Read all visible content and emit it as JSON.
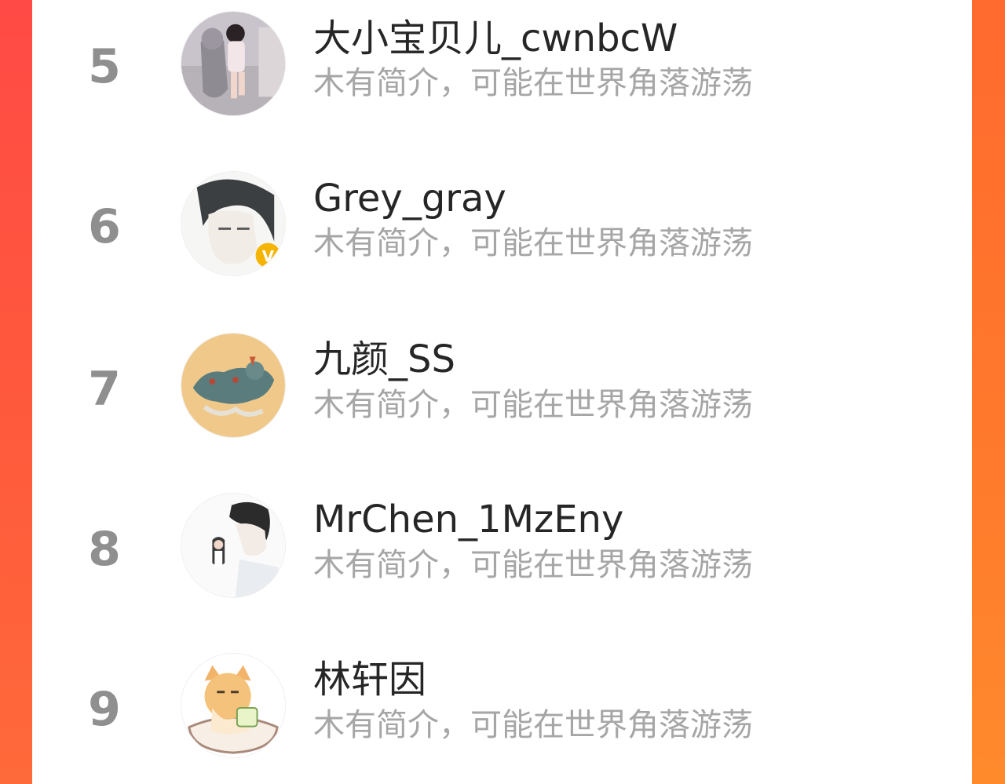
{
  "colors": {
    "left_gradient": "#ff4a45",
    "right_gradient": "#ff7a2c",
    "rank": "#8f8f8f",
    "name": "#262626",
    "bio": "#a6a6a6",
    "badge": "#f5b400"
  },
  "list": [
    {
      "rank": "5",
      "name": "大小宝贝儿_cwnbcW",
      "bio": "木有简介，可能在世界角落游荡",
      "avatar_icon": "child-statue-photo"
    },
    {
      "rank": "6",
      "name": "Grey_gray",
      "bio": "木有简介，可能在世界角落游荡",
      "avatar_icon": "anime-boy-portrait",
      "badge": "V"
    },
    {
      "rank": "7",
      "name": "九颜_SS",
      "bio": "木有简介，可能在世界角落游荡",
      "avatar_icon": "qilin-painting"
    },
    {
      "rank": "8",
      "name": "MrChen_1MzEny",
      "bio": "木有简介，可能在世界角落游荡",
      "avatar_icon": "anime-couple-illustration"
    },
    {
      "rank": "9",
      "name": "林轩因",
      "bio": "木有简介，可能在世界角落游荡",
      "avatar_icon": "cat-cartoon"
    }
  ]
}
